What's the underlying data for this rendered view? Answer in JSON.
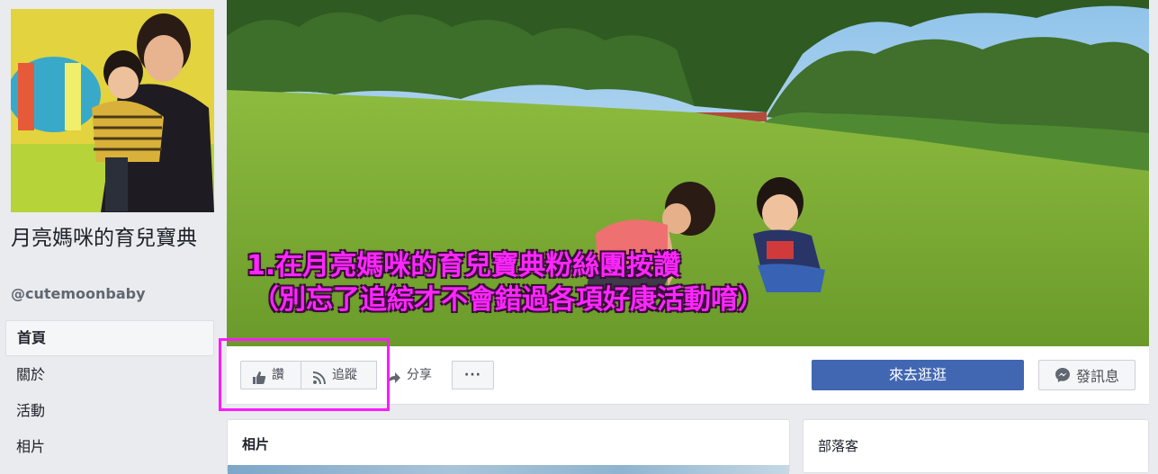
{
  "page": {
    "name": "月亮媽咪的育兒寶典",
    "handle": "@cutemoonbaby"
  },
  "sidebar": {
    "items": [
      {
        "label": "首頁",
        "active": true
      },
      {
        "label": "關於"
      },
      {
        "label": "活動"
      },
      {
        "label": "相片"
      }
    ]
  },
  "cover": {
    "overlay_line1": "1.在月亮媽咪的育兒寶典粉絲團按讚",
    "overlay_line2": "（別忘了追綜才不會錯過各項好康活動唷）",
    "overlay_color": "#ff26ff"
  },
  "actions": {
    "like_label": "讚",
    "follow_label": "追蹤",
    "share_label": "分享",
    "more_label": "···",
    "shop_label": "來去逛逛",
    "message_label": "發訊息",
    "primary_color": "#4267b2",
    "highlight_color": "#ff19ff"
  },
  "cards": {
    "photos_title": "相片",
    "blog_title": "部落客"
  },
  "icons": [
    "thumbs-up-icon",
    "rss-icon",
    "share-arrow-icon",
    "messenger-icon"
  ]
}
